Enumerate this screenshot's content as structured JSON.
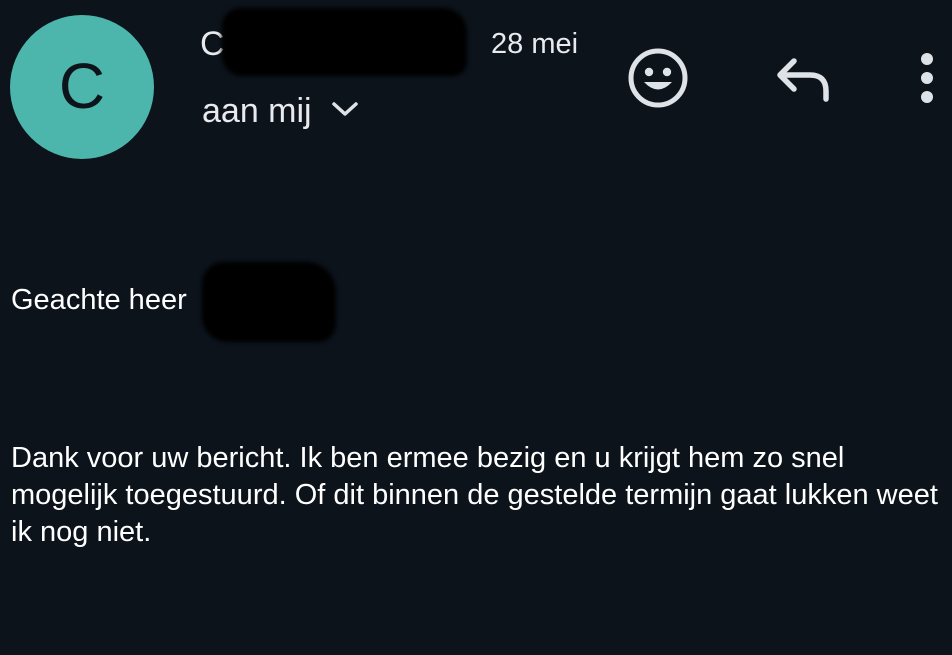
{
  "header": {
    "avatar_letter": "C",
    "sender_name": "C",
    "date": "28 mei",
    "recipient_label": "aan mij",
    "avatar_color": "#4db6ac"
  },
  "actions": {
    "emoji_icon": "smiley-icon",
    "reply_icon": "reply-icon",
    "more_icon": "more-vertical-icon"
  },
  "message": {
    "greeting": "Geachte heer",
    "body": "Dank voor uw bericht. Ik ben ermee bezig en u krijgt hem zo snel mogelijk toegestuurd. Of dit binnen de gestelde termijn gaat lukken weet ik nog niet."
  },
  "colors": {
    "background": "#0c131b",
    "text": "#ffffff",
    "icon": "#dfe3e8"
  }
}
